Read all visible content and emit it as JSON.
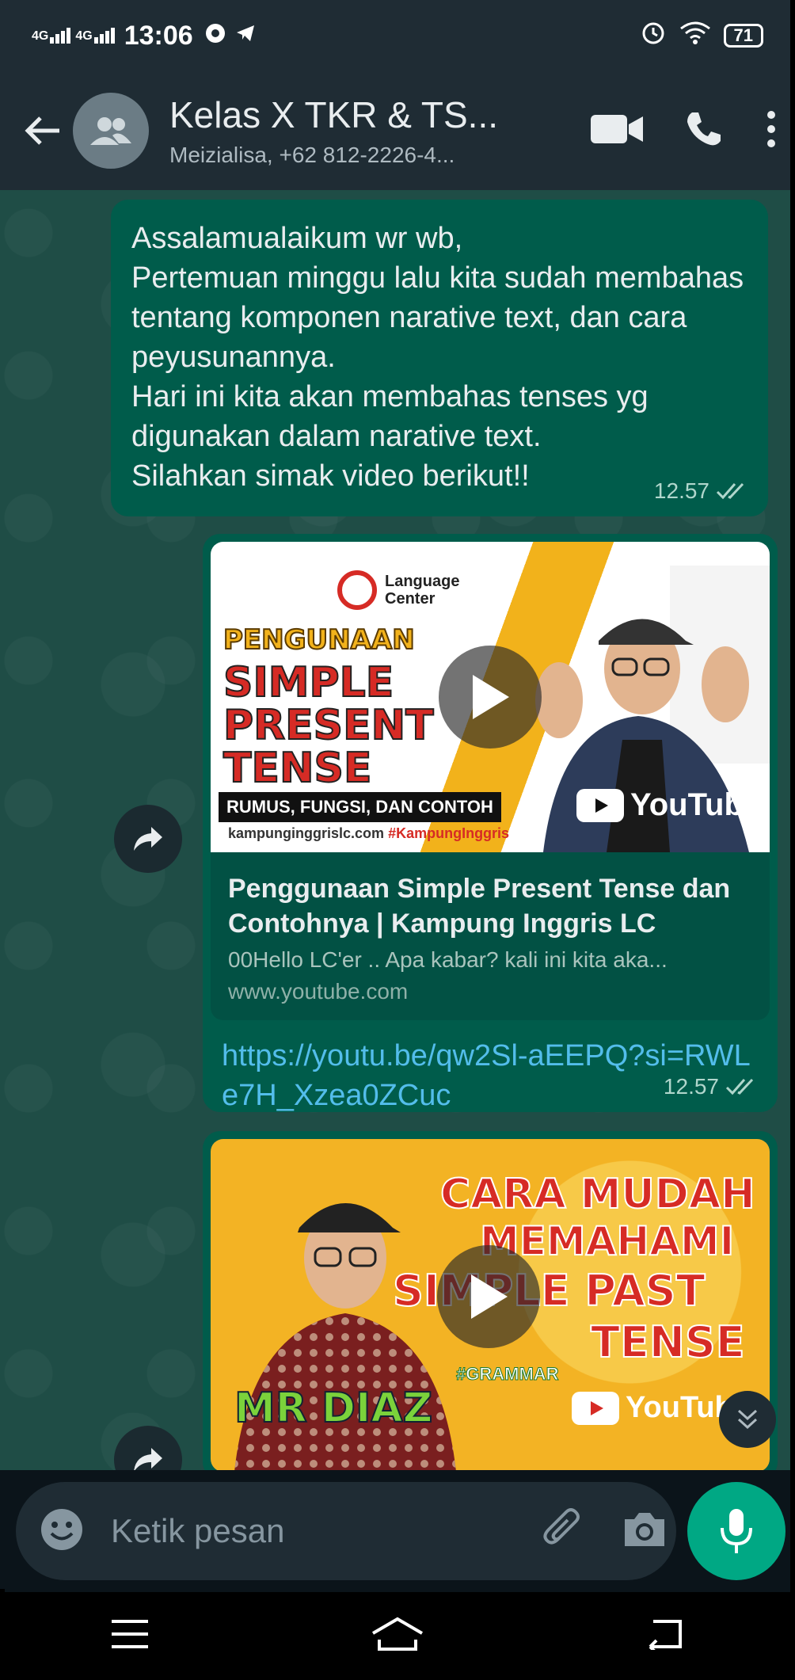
{
  "status_bar": {
    "net_1": "4G",
    "net_2": "4G",
    "time": "13:06",
    "battery": "71"
  },
  "header": {
    "title": "Kelas X TKR & TS...",
    "subtitle": "Meizialisa, +62 812-2226-4..."
  },
  "messages": [
    {
      "text": "Assalamualaikum wr wb,\nPertemuan minggu lalu kita sudah membahas tentang komponen narative text, dan cara peyusunannya.\nHari ini kita akan membahas tenses yg digunakan dalam narative text.\nSilahkan simak video berikut!!",
      "time": "12.57"
    },
    {
      "thumbnail": {
        "logo_line1": "Language",
        "logo_line2": "Center",
        "heading_1": "PENGUNAAN",
        "heading_2": "SIMPLE",
        "heading_3": "PRESENT",
        "heading_4": "TENSE",
        "strip": "RUMUS, FUNGSI, DAN CONTOH",
        "site": "kampunginggrislc.com",
        "hashtag": "#KampungInggris",
        "yt_label": "YouTube"
      },
      "title": "Penggunaan Simple Present Tense dan Contohnya | Kampung Inggris LC",
      "description": "00Hello LC'er .. Apa kabar? kali ini kita aka...",
      "domain": "www.youtube.com",
      "link": "https://youtu.be/qw2Sl-aEEPQ?si=RWLe7H_Xzea0ZCuc",
      "time": "12.57"
    },
    {
      "thumbnail": {
        "line_1": "CARA MUDAH",
        "line_2": "MEMAHAMI",
        "line_3": "SIMPLE PAST",
        "line_4": "TENSE",
        "hashtag": "#GRAMMAR",
        "name": "MR DIAZ",
        "yt_label": "YouTube"
      }
    }
  ],
  "composer": {
    "placeholder": "Ketik pesan"
  },
  "colors": {
    "header_bg": "#1f2c34",
    "outgoing_bubble": "#005c4b",
    "accent_green": "#00a884",
    "link_blue": "#53bdeb",
    "tick_gray": "#b0d6cc"
  },
  "icons": [
    "back-arrow-icon",
    "group-avatar-icon",
    "video-call-icon",
    "phone-icon",
    "more-vert-icon",
    "forward-icon",
    "play-icon",
    "double-check-icon",
    "chevron-double-down-icon",
    "emoji-icon",
    "attach-icon",
    "camera-icon",
    "mic-icon",
    "menu-icon",
    "home-icon",
    "back-nav-icon"
  ]
}
